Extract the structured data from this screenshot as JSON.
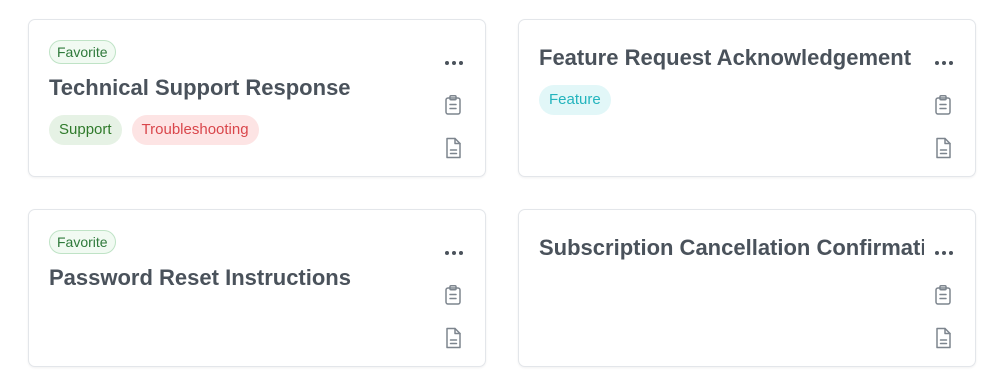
{
  "cards": [
    {
      "title": "Technical Support Response",
      "favorite_label": "Favorite",
      "tags": [
        "Support",
        "Troubleshooting"
      ]
    },
    {
      "title": "Feature Request Acknowledgement",
      "tags": [
        "Feature"
      ]
    },
    {
      "title": "Password Reset Instructions",
      "favorite_label": "Favorite",
      "tags": []
    },
    {
      "title": "Subscription Cancellation Confirmation",
      "tags": []
    }
  ],
  "icons": {
    "more": "more-horizontal-icon",
    "copy": "clipboard-icon",
    "doc": "document-icon"
  },
  "colors": {
    "favorite_text": "#2f7a3b",
    "support_tag_bg": "#e6f2e5",
    "support_tag_text": "#2f7a2b",
    "troubleshooting_tag_bg": "#fde4e4",
    "troubleshooting_tag_text": "#d9464b",
    "feature_tag_bg": "#e2f7f8",
    "feature_tag_text": "#23b4bd"
  }
}
